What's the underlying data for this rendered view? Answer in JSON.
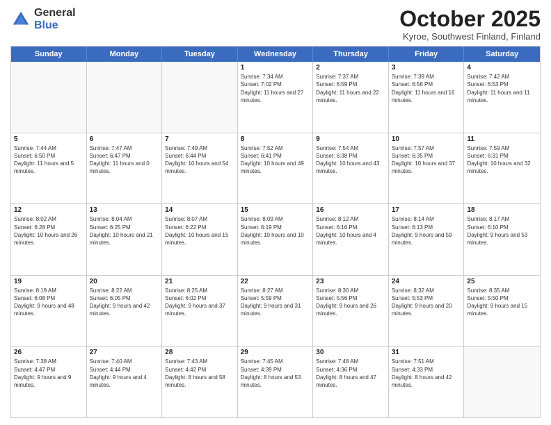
{
  "header": {
    "logo_general": "General",
    "logo_blue": "Blue",
    "month": "October 2025",
    "location": "Kyroe, Southwest Finland, Finland"
  },
  "days": [
    "Sunday",
    "Monday",
    "Tuesday",
    "Wednesday",
    "Thursday",
    "Friday",
    "Saturday"
  ],
  "weeks": [
    [
      {
        "day": "",
        "text": ""
      },
      {
        "day": "",
        "text": ""
      },
      {
        "day": "",
        "text": ""
      },
      {
        "day": "1",
        "text": "Sunrise: 7:34 AM\nSunset: 7:02 PM\nDaylight: 11 hours and 27 minutes."
      },
      {
        "day": "2",
        "text": "Sunrise: 7:37 AM\nSunset: 6:59 PM\nDaylight: 11 hours and 22 minutes."
      },
      {
        "day": "3",
        "text": "Sunrise: 7:39 AM\nSunset: 6:56 PM\nDaylight: 11 hours and 16 minutes."
      },
      {
        "day": "4",
        "text": "Sunrise: 7:42 AM\nSunset: 6:53 PM\nDaylight: 11 hours and 11 minutes."
      }
    ],
    [
      {
        "day": "5",
        "text": "Sunrise: 7:44 AM\nSunset: 6:50 PM\nDaylight: 11 hours and 5 minutes."
      },
      {
        "day": "6",
        "text": "Sunrise: 7:47 AM\nSunset: 6:47 PM\nDaylight: 11 hours and 0 minutes."
      },
      {
        "day": "7",
        "text": "Sunrise: 7:49 AM\nSunset: 6:44 PM\nDaylight: 10 hours and 54 minutes."
      },
      {
        "day": "8",
        "text": "Sunrise: 7:52 AM\nSunset: 6:41 PM\nDaylight: 10 hours and 49 minutes."
      },
      {
        "day": "9",
        "text": "Sunrise: 7:54 AM\nSunset: 6:38 PM\nDaylight: 10 hours and 43 minutes."
      },
      {
        "day": "10",
        "text": "Sunrise: 7:57 AM\nSunset: 6:35 PM\nDaylight: 10 hours and 37 minutes."
      },
      {
        "day": "11",
        "text": "Sunrise: 7:59 AM\nSunset: 6:31 PM\nDaylight: 10 hours and 32 minutes."
      }
    ],
    [
      {
        "day": "12",
        "text": "Sunrise: 8:02 AM\nSunset: 6:28 PM\nDaylight: 10 hours and 26 minutes."
      },
      {
        "day": "13",
        "text": "Sunrise: 8:04 AM\nSunset: 6:25 PM\nDaylight: 10 hours and 21 minutes."
      },
      {
        "day": "14",
        "text": "Sunrise: 8:07 AM\nSunset: 6:22 PM\nDaylight: 10 hours and 15 minutes."
      },
      {
        "day": "15",
        "text": "Sunrise: 8:09 AM\nSunset: 6:19 PM\nDaylight: 10 hours and 10 minutes."
      },
      {
        "day": "16",
        "text": "Sunrise: 8:12 AM\nSunset: 6:16 PM\nDaylight: 10 hours and 4 minutes."
      },
      {
        "day": "17",
        "text": "Sunrise: 8:14 AM\nSunset: 6:13 PM\nDaylight: 9 hours and 59 minutes."
      },
      {
        "day": "18",
        "text": "Sunrise: 8:17 AM\nSunset: 6:10 PM\nDaylight: 9 hours and 53 minutes."
      }
    ],
    [
      {
        "day": "19",
        "text": "Sunrise: 8:19 AM\nSunset: 6:08 PM\nDaylight: 9 hours and 48 minutes."
      },
      {
        "day": "20",
        "text": "Sunrise: 8:22 AM\nSunset: 6:05 PM\nDaylight: 9 hours and 42 minutes."
      },
      {
        "day": "21",
        "text": "Sunrise: 8:25 AM\nSunset: 6:02 PM\nDaylight: 9 hours and 37 minutes."
      },
      {
        "day": "22",
        "text": "Sunrise: 8:27 AM\nSunset: 5:59 PM\nDaylight: 9 hours and 31 minutes."
      },
      {
        "day": "23",
        "text": "Sunrise: 8:30 AM\nSunset: 5:56 PM\nDaylight: 9 hours and 26 minutes."
      },
      {
        "day": "24",
        "text": "Sunrise: 8:32 AM\nSunset: 5:53 PM\nDaylight: 9 hours and 20 minutes."
      },
      {
        "day": "25",
        "text": "Sunrise: 8:35 AM\nSunset: 5:50 PM\nDaylight: 9 hours and 15 minutes."
      }
    ],
    [
      {
        "day": "26",
        "text": "Sunrise: 7:38 AM\nSunset: 4:47 PM\nDaylight: 9 hours and 9 minutes."
      },
      {
        "day": "27",
        "text": "Sunrise: 7:40 AM\nSunset: 4:44 PM\nDaylight: 9 hours and 4 minutes."
      },
      {
        "day": "28",
        "text": "Sunrise: 7:43 AM\nSunset: 4:42 PM\nDaylight: 8 hours and 58 minutes."
      },
      {
        "day": "29",
        "text": "Sunrise: 7:45 AM\nSunset: 4:39 PM\nDaylight: 8 hours and 53 minutes."
      },
      {
        "day": "30",
        "text": "Sunrise: 7:48 AM\nSunset: 4:36 PM\nDaylight: 8 hours and 47 minutes."
      },
      {
        "day": "31",
        "text": "Sunrise: 7:51 AM\nSunset: 4:33 PM\nDaylight: 8 hours and 42 minutes."
      },
      {
        "day": "",
        "text": ""
      }
    ]
  ]
}
